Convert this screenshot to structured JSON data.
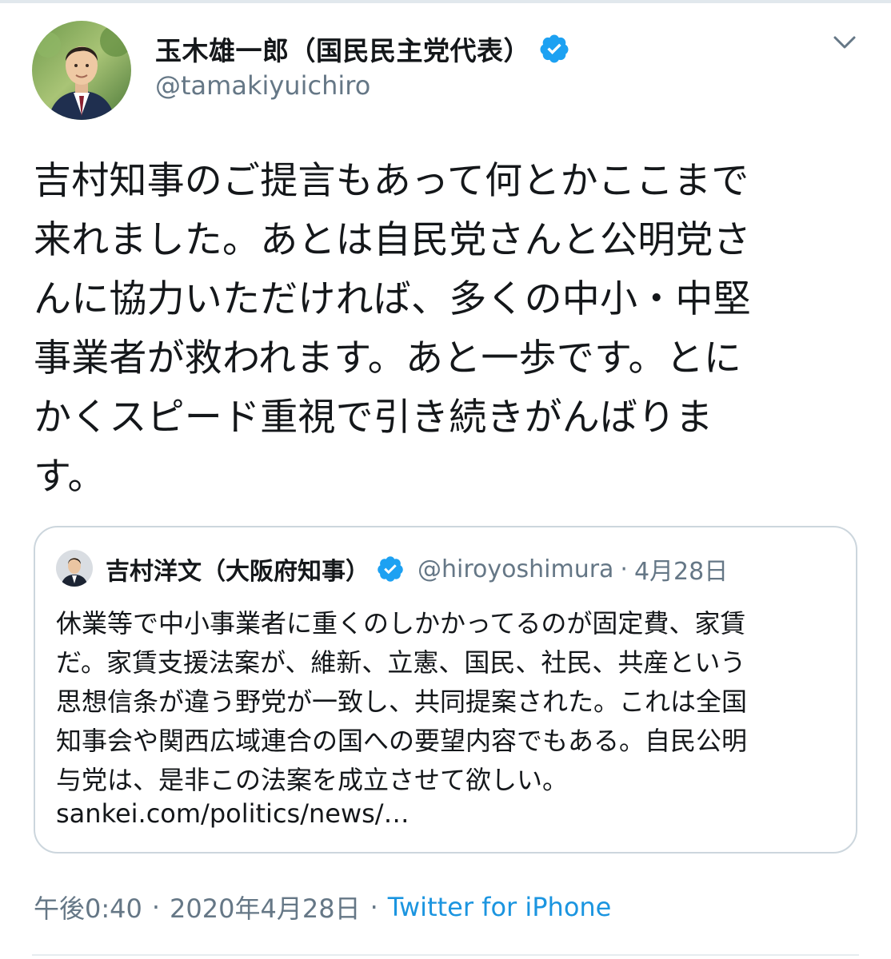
{
  "author": {
    "display_name": "玉木雄一郎（国民民主党代表）",
    "handle": "@tamakiyuichiro",
    "verified": true,
    "avatar_icon": "profile-photo"
  },
  "tweet": {
    "lines": [
      "吉村知事のご提言もあって何とかここまで",
      "来れました。あとは自民党さんと公明党さ",
      "んに協力いただければ、多くの中小・中堅",
      "事業者が救われます。あと一歩です。とに",
      "かくスピード重視で引き続きがんばりま",
      "す。"
    ]
  },
  "quote": {
    "display_name": "吉村洋文（大阪府知事）",
    "handle": "@hiroyoshimura",
    "separator": "·",
    "date": "4月28日",
    "verified": true,
    "lines": [
      "休業等で中小事業者に重くのしかかってるのが固定費、家賃",
      "だ。家賃支援法案が、維新、立憲、国民、社民、共産という",
      "思想信条が違う野党が一致し、共同提案された。これは全国",
      "知事会や関西広域連合の国への要望内容でもある。自民公明",
      "与党は、是非この法案を成立させて欲しい。"
    ],
    "link": "sankei.com/politics/news/…"
  },
  "meta": {
    "time": "午後0:40",
    "separator": "·",
    "date": "2020年4月28日",
    "source": "Twitter for iPhone"
  },
  "colors": {
    "verified": "#1da1f2",
    "link": "#1b95e0",
    "muted": "#657786",
    "text": "#14171a",
    "border": "#ccd6dd"
  },
  "icons": {
    "caret": "chevron-down-icon",
    "verified": "verified-badge-icon"
  }
}
